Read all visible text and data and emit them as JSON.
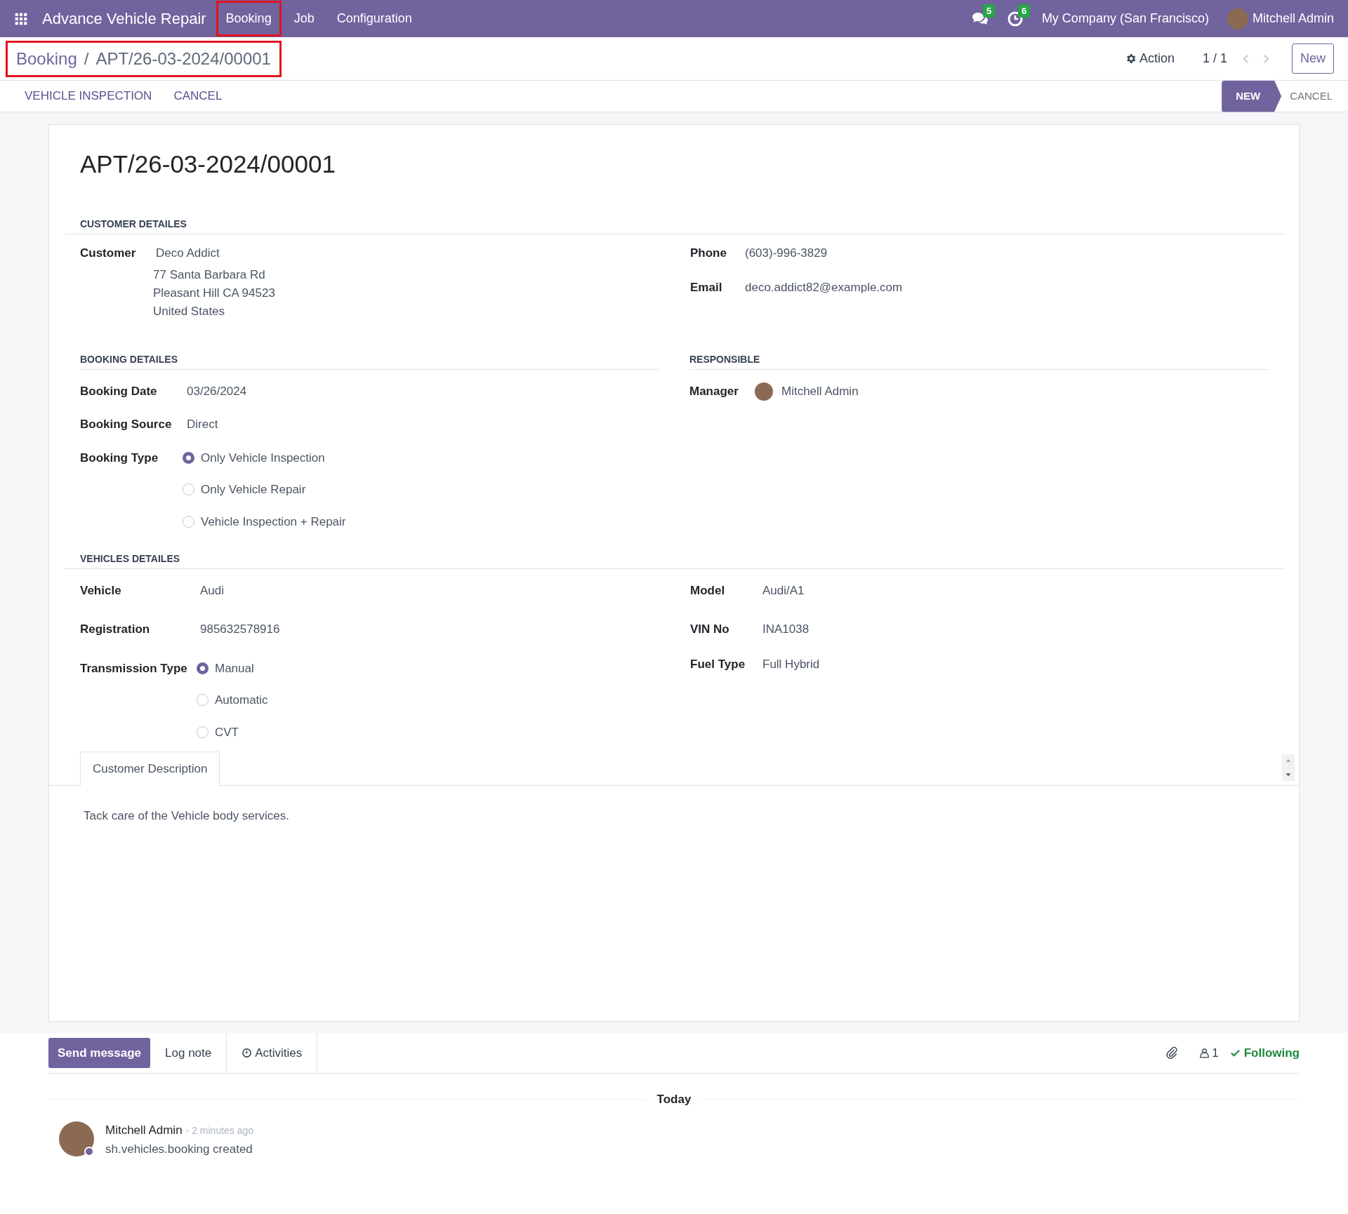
{
  "navbar": {
    "app_name": "Advance Vehicle Repair",
    "menu": [
      {
        "label": "Booking",
        "highlighted": true,
        "selected": false
      },
      {
        "label": "Job",
        "highlighted": false,
        "selected": false
      },
      {
        "label": "Configuration",
        "highlighted": false,
        "selected": false
      }
    ],
    "messages_count": "5",
    "activities_count": "6",
    "company": "My Company (San Francisco)",
    "user": "Mitchell Admin"
  },
  "breadcrumb": {
    "items": [
      "Booking",
      "/",
      "APT/26-03-2024/00001"
    ],
    "highlighted": true
  },
  "control_panel": {
    "action": "Action",
    "pager": "1 / 1",
    "new_button": "New"
  },
  "header_buttons": [
    "VEHICLE INSPECTION",
    "CANCEL"
  ],
  "status_bar": [
    {
      "label": "NEW",
      "selected": true
    },
    {
      "label": "CANCEL",
      "selected": false
    }
  ],
  "form": {
    "title": "APT/26-03-2024/00001",
    "customer_section": {
      "heading": "CUSTOMER DETAILES",
      "customer": {
        "label": "Customer",
        "name": "Deco Addict",
        "address": [
          "77 Santa Barbara Rd",
          "Pleasant Hill CA 94523",
          "United States"
        ]
      },
      "right": [
        {
          "label": "Phone",
          "value": "(603)-996-3829"
        },
        {
          "label": "Email",
          "value": "deco.addict82@example.com"
        }
      ]
    },
    "booking_section": {
      "heading": "BOOKING DETAILES",
      "fields": [
        {
          "label": "Booking Date",
          "value": "03/26/2024"
        },
        {
          "label": "Booking Source",
          "value": "Direct"
        }
      ],
      "booking_type": {
        "label": "Booking Type",
        "options": [
          {
            "label": "Only Vehicle Inspection",
            "selected": true
          },
          {
            "label": "Only Vehicle Repair",
            "selected": false
          },
          {
            "label": "Vehicle Inspection + Repair",
            "selected": false
          }
        ]
      }
    },
    "responsible_section": {
      "heading": "RESPONSIBLE",
      "manager": {
        "label": "Manager",
        "value": "Mitchell Admin"
      }
    },
    "vehicles_section": {
      "heading": "VEHICLES DETAILES",
      "left": [
        {
          "label": "Vehicle",
          "value": "Audi"
        },
        {
          "label": "Registration",
          "value": "985632578916"
        }
      ],
      "transmission": {
        "label": "Transmission Type",
        "options": [
          {
            "label": "Manual",
            "selected": true
          },
          {
            "label": "Automatic",
            "selected": false
          },
          {
            "label": "CVT",
            "selected": false
          }
        ]
      },
      "right": [
        {
          "label": "Model",
          "value": "Audi/A1"
        },
        {
          "label": "VIN No",
          "value": "INA1038"
        },
        {
          "label": "Fuel Type",
          "value": "Full Hybrid"
        }
      ]
    },
    "notebook": {
      "tabs": [
        {
          "label": "Customer Description",
          "selected": true
        }
      ],
      "content": "Tack care of the Vehicle body services."
    }
  },
  "chatter": {
    "send_message": "Send message",
    "log_note": "Log note",
    "activities": "Activities",
    "followers_count": "1",
    "following": "Following",
    "date_separator": "Today",
    "messages": [
      {
        "author": "Mitchell Admin",
        "time": "- 2 minutes ago",
        "body": "sh.vehicles.booking created"
      }
    ]
  }
}
